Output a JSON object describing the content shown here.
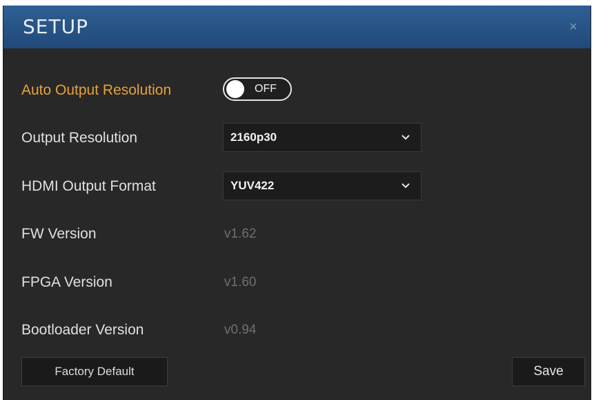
{
  "dialog": {
    "title": "SETUP",
    "close_label": "×"
  },
  "auto_output_resolution": {
    "label": "Auto Output Resolution",
    "toggle_state": "OFF",
    "enabled": false
  },
  "output_resolution": {
    "label": "Output Resolution",
    "selected": "2160p30"
  },
  "hdmi_output_format": {
    "label": "HDMI Output Format",
    "selected": "YUV422"
  },
  "fw_version": {
    "label": "FW Version",
    "value": "v1.62"
  },
  "fpga_version": {
    "label": "FPGA Version",
    "value": "v1.60"
  },
  "bootloader_version": {
    "label": "Bootloader Version",
    "value": "v0.94"
  },
  "buttons": {
    "factory_default": "Factory Default",
    "save": "Save"
  },
  "colors": {
    "titlebar": "#2a5a8e",
    "background": "#282828",
    "accent_label": "#e8a23a",
    "muted_value": "#6f6f6f"
  },
  "icons": {
    "close": "close-icon",
    "dropdown": "chevron-down-icon"
  }
}
